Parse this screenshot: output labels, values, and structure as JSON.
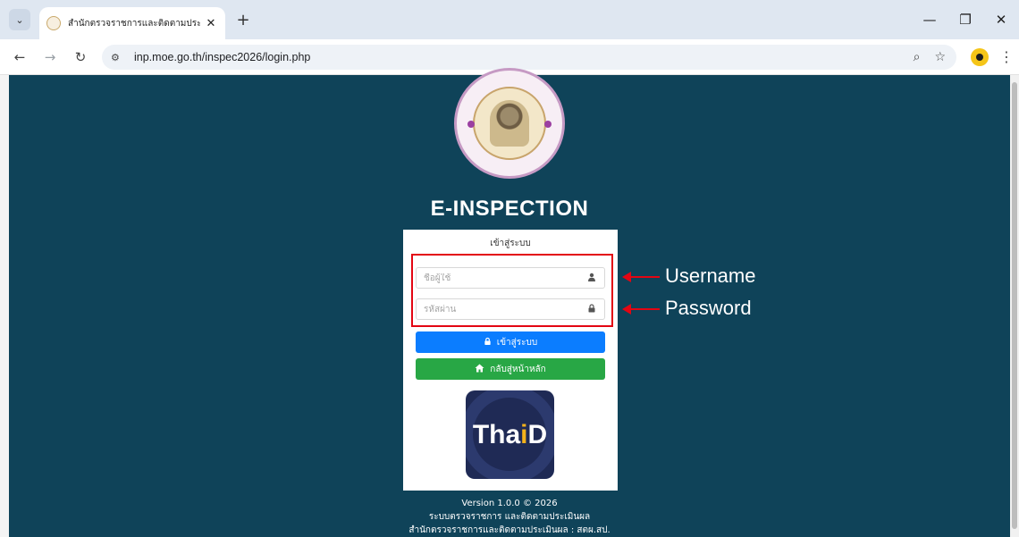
{
  "browser": {
    "tab_title": "สำนักตรวจราชการและติดตามประเมิน",
    "url": "inp.moe.go.th/inspec2026/login.php"
  },
  "page": {
    "app_title": "E-INSPECTION",
    "login_card": {
      "title": "เข้าสู่ระบบ",
      "username_placeholder": "ชื่อผู้ใช้",
      "password_placeholder": "รหัสผ่าน",
      "login_button": "เข้าสู่ระบบ",
      "home_button": "กลับสู่หน้าหลัก",
      "thaid_logo_text": "ThaiD"
    },
    "footer": {
      "version": "Version 1.0.0 © 2026",
      "system_name": "ระบบตรวจราชการ และติดตามประเมินผล",
      "office": "สำนักตรวจราชการและติดตามประเมินผล : สตผ.สป."
    }
  },
  "annotations": {
    "username_label": "Username",
    "password_label": "Password",
    "highlight_color": "#e30613"
  },
  "colors": {
    "page_background": "#0f4359",
    "login_button": "#0b7dff",
    "home_button": "#28a745"
  },
  "icons": {
    "username_field": "user-icon",
    "password_field": "lock-icon",
    "login_button": "lock-icon",
    "home_button": "home-icon"
  }
}
